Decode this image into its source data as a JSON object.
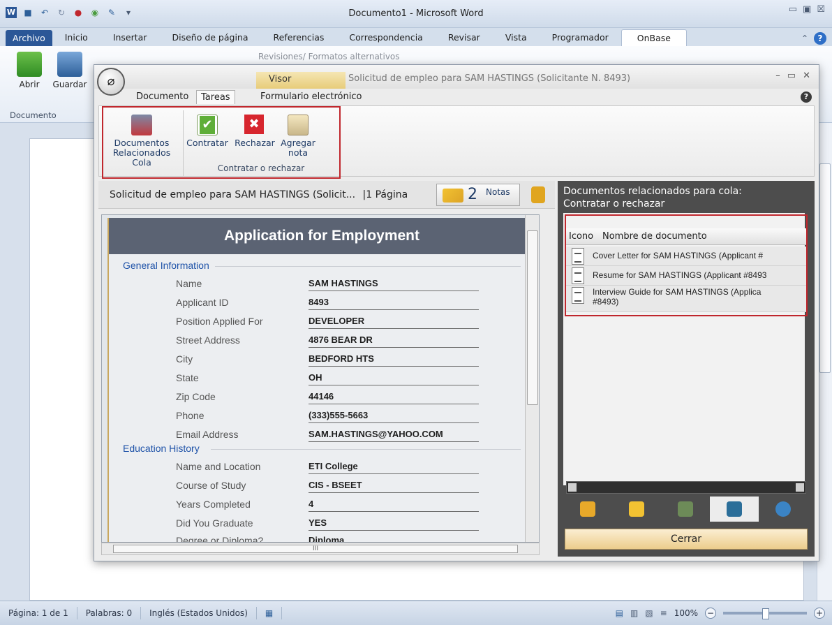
{
  "word": {
    "title": "Documento1 - Microsoft Word",
    "tabs": [
      "Archivo",
      "Inicio",
      "Insertar",
      "Diseño de página",
      "Referencias",
      "Correspondencia",
      "Revisar",
      "Vista",
      "Programador",
      "OnBase"
    ],
    "active_tab": "OnBase",
    "ribbon": {
      "open_label": "Abrir",
      "save_label": "Guardar",
      "group_label": "Documento",
      "revisions_label": "Revisiones/ Formatos alternativos"
    },
    "status": {
      "page": "Página: 1 de 1",
      "words": "Palabras: 0",
      "language": "Inglés (Estados Unidos)",
      "zoom": "100%"
    }
  },
  "onbase": {
    "viewer_tab": "Visor",
    "title": "Solicitud de empleo para SAM HASTINGS (Solicitante N. 8493)",
    "tabs": [
      "Documento",
      "Tareas",
      "Formulario electrónico"
    ],
    "active_tab": "Tareas",
    "tools": {
      "related_docs": "Documentos Relacionados Cola",
      "hire": "Contratar",
      "reject": "Rechazar",
      "add_note": "Agregar nota",
      "group_label": "Contratar o rechazar"
    },
    "doc_header": {
      "title": "Solicitud de empleo para SAM HASTINGS (Solicit...",
      "pages": "|1 Página",
      "notes_count": "2",
      "notes_label": "Notas"
    },
    "form": {
      "title": "Application for Employment",
      "general_section": "General Information",
      "general_fields": [
        {
          "label": "Name",
          "value": "SAM HASTINGS"
        },
        {
          "label": "Applicant ID",
          "value": "8493"
        },
        {
          "label": "Position Applied For",
          "value": "DEVELOPER"
        },
        {
          "label": "Street Address",
          "value": "4876 BEAR DR"
        },
        {
          "label": "City",
          "value": "BEDFORD HTS"
        },
        {
          "label": "State",
          "value": "OH"
        },
        {
          "label": "Zip Code",
          "value": "44146"
        },
        {
          "label": "Phone",
          "value": "(333)555-5663"
        },
        {
          "label": "Email Address",
          "value": "SAM.HASTINGS@YAHOO.COM"
        }
      ],
      "education_section": "Education History",
      "education_fields": [
        {
          "label": "Name and Location",
          "value": "ETI College"
        },
        {
          "label": "Course of Study",
          "value": "CIS - BSEET"
        },
        {
          "label": "Years Completed",
          "value": "4"
        },
        {
          "label": "Did You Graduate",
          "value": "YES"
        },
        {
          "label": "Degree or Diploma?",
          "value": "Diploma"
        }
      ],
      "hscroll_marker": "III"
    },
    "related": {
      "title_line1": "Documentos relacionados para cola:",
      "title_line2": "Contratar o rechazar",
      "col_icon": "Icono",
      "col_name": "Nombre de documento",
      "docs": [
        "Cover Letter for SAM HASTINGS (Applicant #",
        "Resume for SAM HASTINGS (Applicant #8493",
        "Interview Guide for SAM HASTINGS (Applica",
        "#8493)"
      ],
      "close_label": "Cerrar"
    }
  }
}
